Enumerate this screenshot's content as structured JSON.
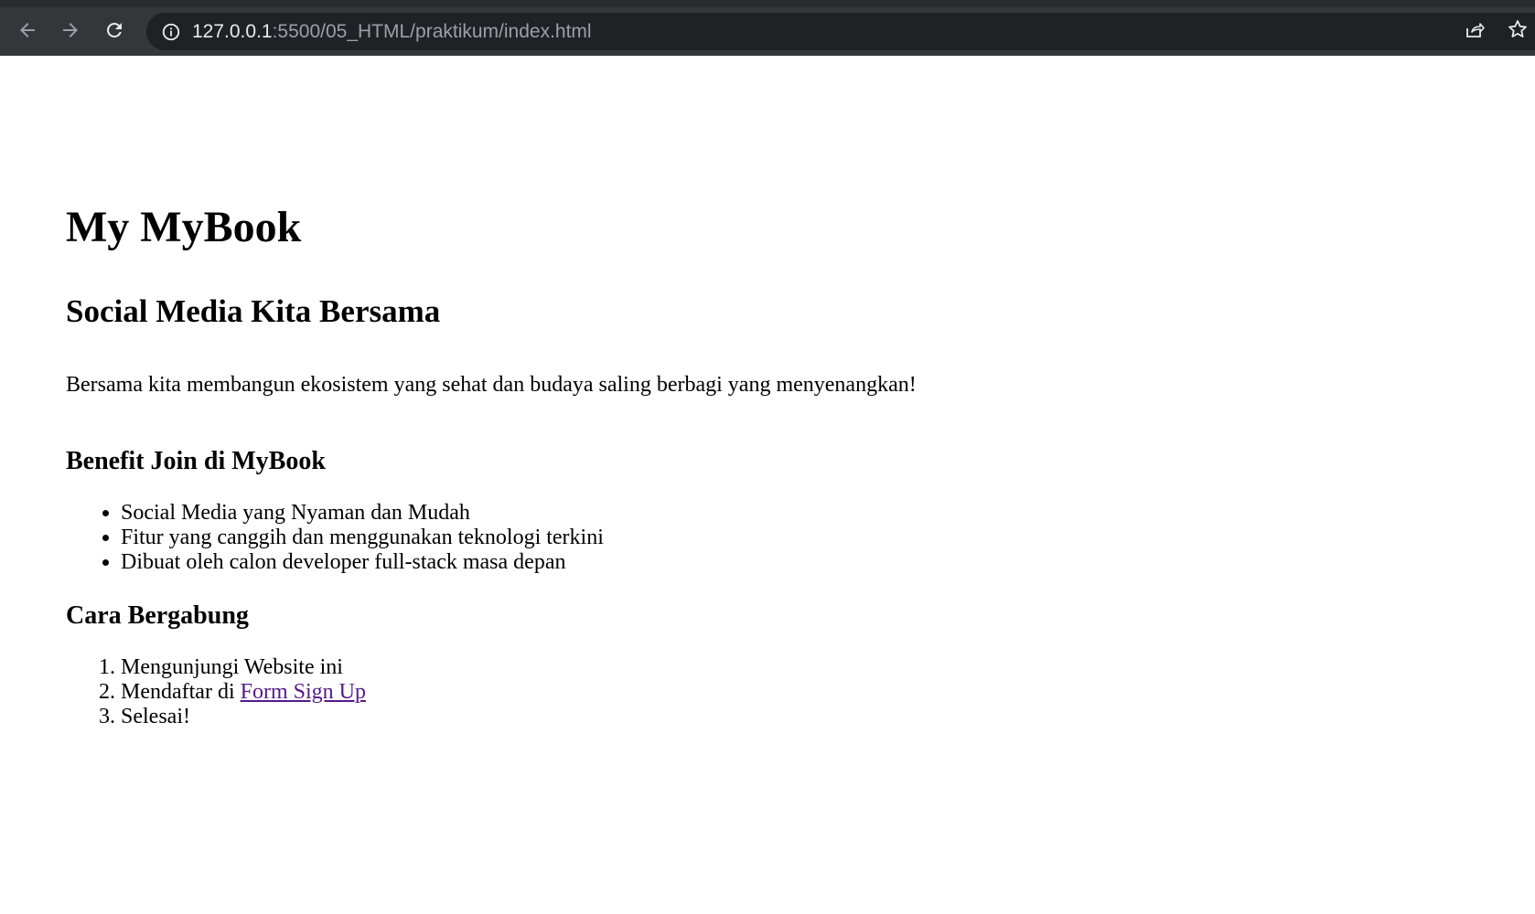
{
  "browser": {
    "url_host": "127.0.0.1",
    "url_path": ":5500/05_HTML/praktikum/index.html",
    "icons": [
      "back-arrow-icon",
      "forward-arrow-icon",
      "reload-icon",
      "info-icon",
      "share-icon",
      "star-icon"
    ]
  },
  "content": {
    "title": "My MyBook",
    "subtitle": "Social Media Kita Bersama",
    "tagline": "Bersama kita membangun ekosistem yang sehat dan budaya saling berbagi yang menyenangkan!",
    "benefit_heading": "Benefit Join di MyBook",
    "benefits": [
      "Social Media yang Nyaman dan Mudah",
      "Fitur yang canggih dan menggunakan teknologi terkini",
      "Dibuat oleh calon developer full-stack masa depan"
    ],
    "join_heading": "Cara Bergabung",
    "steps": {
      "step1": "Mengunjungi Website ini",
      "step2_prefix": "Mendaftar di ",
      "step2_link": "Form Sign Up",
      "step3": "Selesai!"
    }
  },
  "colors": {
    "toolbar_bg": "#35363a",
    "omnibox_bg": "#202124",
    "visited_link": "#551a8b"
  }
}
